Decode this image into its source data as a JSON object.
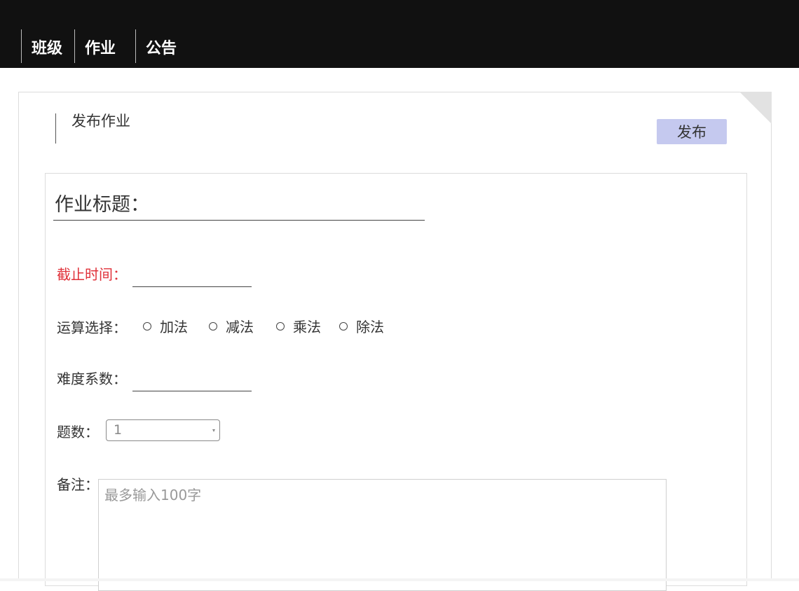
{
  "nav": {
    "items": [
      "班级",
      "作业",
      "公告"
    ]
  },
  "page": {
    "title": "发布作业",
    "publish_label": "发布"
  },
  "form": {
    "title_placeholder": "作业标题：",
    "deadline_label": "截止时间：",
    "operation_label": "运算选择：",
    "operations": [
      "加法",
      "减法",
      "乘法",
      "除法"
    ],
    "difficulty_label": "难度系数：",
    "count_label": "题数：",
    "count_value": "1",
    "notes_label": "备注：",
    "notes_placeholder": "最多输入100字"
  },
  "colors": {
    "topbar": "#111111",
    "publish_button": "#c5c9ef",
    "deadline_label": "#e0323a"
  }
}
